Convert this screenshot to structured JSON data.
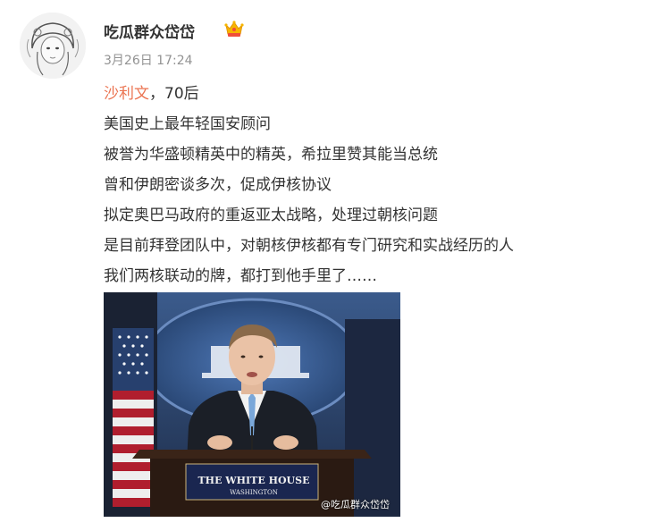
{
  "post": {
    "author": "吃瓜群众岱岱",
    "badge_icon": "crown-icon",
    "timestamp": "3月26日 17:24",
    "mention": "沙利文",
    "first_line_rest": "，70后",
    "lines": [
      "美国史上最年轻国安顾问",
      "被誉为华盛顿精英中的精英，希拉里赞其能当总统",
      "曾和伊朗密谈多次，促成伊核协议",
      "拟定奥巴马政府的重返亚太战略，处理过朝核问题",
      "是目前拜登团队中，对朝核伊核都有专门研究和实战经历的人",
      "我们两核联动的牌，都打到他手里了……"
    ],
    "image": {
      "podium_title": "THE WHITE HOUSE",
      "podium_subtitle": "WASHINGTON",
      "watermark": "@吃瓜群众岱岱"
    }
  },
  "colors": {
    "mention": "#eb7350",
    "text": "#333333",
    "meta": "#939393"
  }
}
